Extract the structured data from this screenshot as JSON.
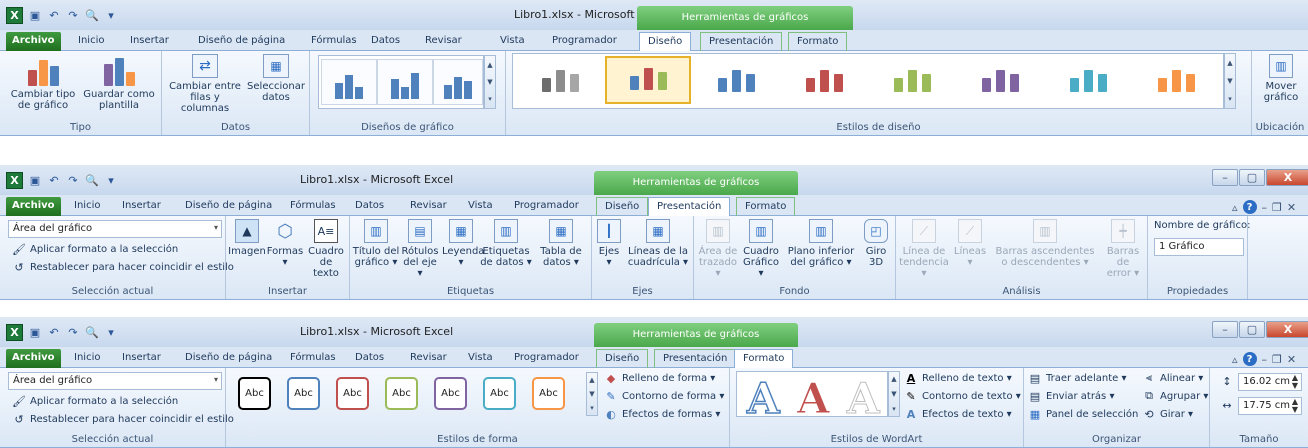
{
  "common": {
    "qat_excel_icon": "X",
    "file_tab": "Archivo",
    "inicio": "Inicio",
    "insertar": "Insertar",
    "diseno_pagina": "Diseño de página",
    "formulas": "Fórmulas",
    "datos": "Datos",
    "revisar": "Revisar",
    "vista": "Vista",
    "programador": "Programador",
    "window_title": "Libro1.xlsx  -  Microsoft Excel",
    "context_title": "Herramientas de gráficos",
    "tab_diseno": "Diseño",
    "tab_presentacion": "Presentación",
    "tab_formato": "Formato",
    "window_buttons": [
      "–",
      "▢",
      "X"
    ],
    "help": "?",
    "icons": [
      "excel-icon",
      "save-icon",
      "undo-icon",
      "redo-icon",
      "print-preview-icon"
    ]
  },
  "s1": {
    "active_tab": "Diseño",
    "groups": {
      "tipo": "Tipo",
      "datos": "Datos",
      "disenos": "Diseños de gráfico",
      "estilos": "Estilos de diseño",
      "ubicacion": "Ubicación"
    },
    "buttons": {
      "cambiar_tipo": "Cambiar tipo\nde gráfico",
      "guardar_plantilla": "Guardar como\nplantilla",
      "cambiar_filas": "Cambiar entre\nfilas y columnas",
      "seleccionar_datos": "Seleccionar\ndatos",
      "mover": "Mover\ngráfico"
    },
    "styles": [
      {
        "colors": [
          "#6d6d6d",
          "#8c8c8c",
          "#a6a6a6"
        ],
        "selected": false
      },
      {
        "colors": [
          "#4f81bd",
          "#c0504d",
          "#9bbb59"
        ],
        "selected": true
      },
      {
        "colors": [
          "#4f81bd",
          "#4f81bd",
          "#4f81bd"
        ],
        "selected": false
      },
      {
        "colors": [
          "#c0504d",
          "#c0504d",
          "#c0504d"
        ],
        "selected": false
      },
      {
        "colors": [
          "#9bbb59",
          "#9bbb59",
          "#9bbb59"
        ],
        "selected": false
      },
      {
        "colors": [
          "#8064a2",
          "#8064a2",
          "#8064a2"
        ],
        "selected": false
      },
      {
        "colors": [
          "#4bacc6",
          "#4bacc6",
          "#4bacc6"
        ],
        "selected": false
      },
      {
        "colors": [
          "#f79646",
          "#f79646",
          "#f79646"
        ],
        "selected": false
      }
    ]
  },
  "s2": {
    "active_tab": "Presentación",
    "selection_combo": "Área del gráfico",
    "aplicar_formato": "Aplicar formato a la selección",
    "restablecer": "Restablecer para hacer coincidir el estilo",
    "groups": {
      "seleccion": "Selección actual",
      "insertar": "Insertar",
      "etiquetas": "Etiquetas",
      "ejes": "Ejes",
      "fondo": "Fondo",
      "analisis": "Análisis",
      "propiedades": "Propiedades"
    },
    "buttons": {
      "imagen": "Imagen",
      "formas": "Formas\n▾",
      "cuadro_texto": "Cuadro\nde texto",
      "titulo": "Título del\ngráfico ▾",
      "rotulos": "Rótulos\ndel eje ▾",
      "leyenda": "Leyenda\n▾",
      "etiquetas_datos": "Etiquetas\nde datos ▾",
      "tabla_datos": "Tabla de\ndatos ▾",
      "ejes": "Ejes\n▾",
      "lineas_cuadricula": "Líneas de la\ncuadrícula ▾",
      "area_trazado": "Área de\ntrazado ▾",
      "cuadro_grafico": "Cuadro\nGráfico ▾",
      "plano_inferior": "Plano inferior\ndel gráfico ▾",
      "giro": "Giro\n3D",
      "linea_tendencia": "Línea de\ntendencia ▾",
      "lineas": "Líneas\n▾",
      "barras_asc": "Barras ascendentes\no descendentes ▾",
      "barras_error": "Barras de\nerror ▾"
    },
    "nombre_label": "Nombre de gráfico:",
    "nombre_value": "1 Gráfico"
  },
  "s3": {
    "active_tab": "Formato",
    "selection_combo": "Área del gráfico",
    "aplicar_formato": "Aplicar formato a la selección",
    "restablecer": "Restablecer para hacer coincidir el estilo",
    "groups": {
      "seleccion": "Selección actual",
      "estilos_forma": "Estilos de forma",
      "wordart": "Estilos de WordArt",
      "organizar": "Organizar",
      "tamano": "Tamaño"
    },
    "shape_label": "Abc",
    "shape_colors": [
      "#000000",
      "#4f81bd",
      "#c0504d",
      "#9bbb59",
      "#8064a2",
      "#4bacc6",
      "#f79646"
    ],
    "relleno_forma": "Relleno de forma ▾",
    "contorno_forma": "Contorno de forma ▾",
    "efectos_formas": "Efectos de formas ▾",
    "wordart_letter": "A",
    "relleno_texto": "Relleno de texto ▾",
    "contorno_texto": "Contorno de texto ▾",
    "efectos_texto": "Efectos de texto ▾",
    "traer_adelante": "Traer adelante ▾",
    "enviar_atras": "Enviar atrás ▾",
    "panel_seleccion": "Panel de selección",
    "alinear": "Alinear ▾",
    "agrupar": "Agrupar ▾",
    "girar": "Girar ▾",
    "alto": "16.02 cm",
    "ancho": "17.75 cm"
  }
}
